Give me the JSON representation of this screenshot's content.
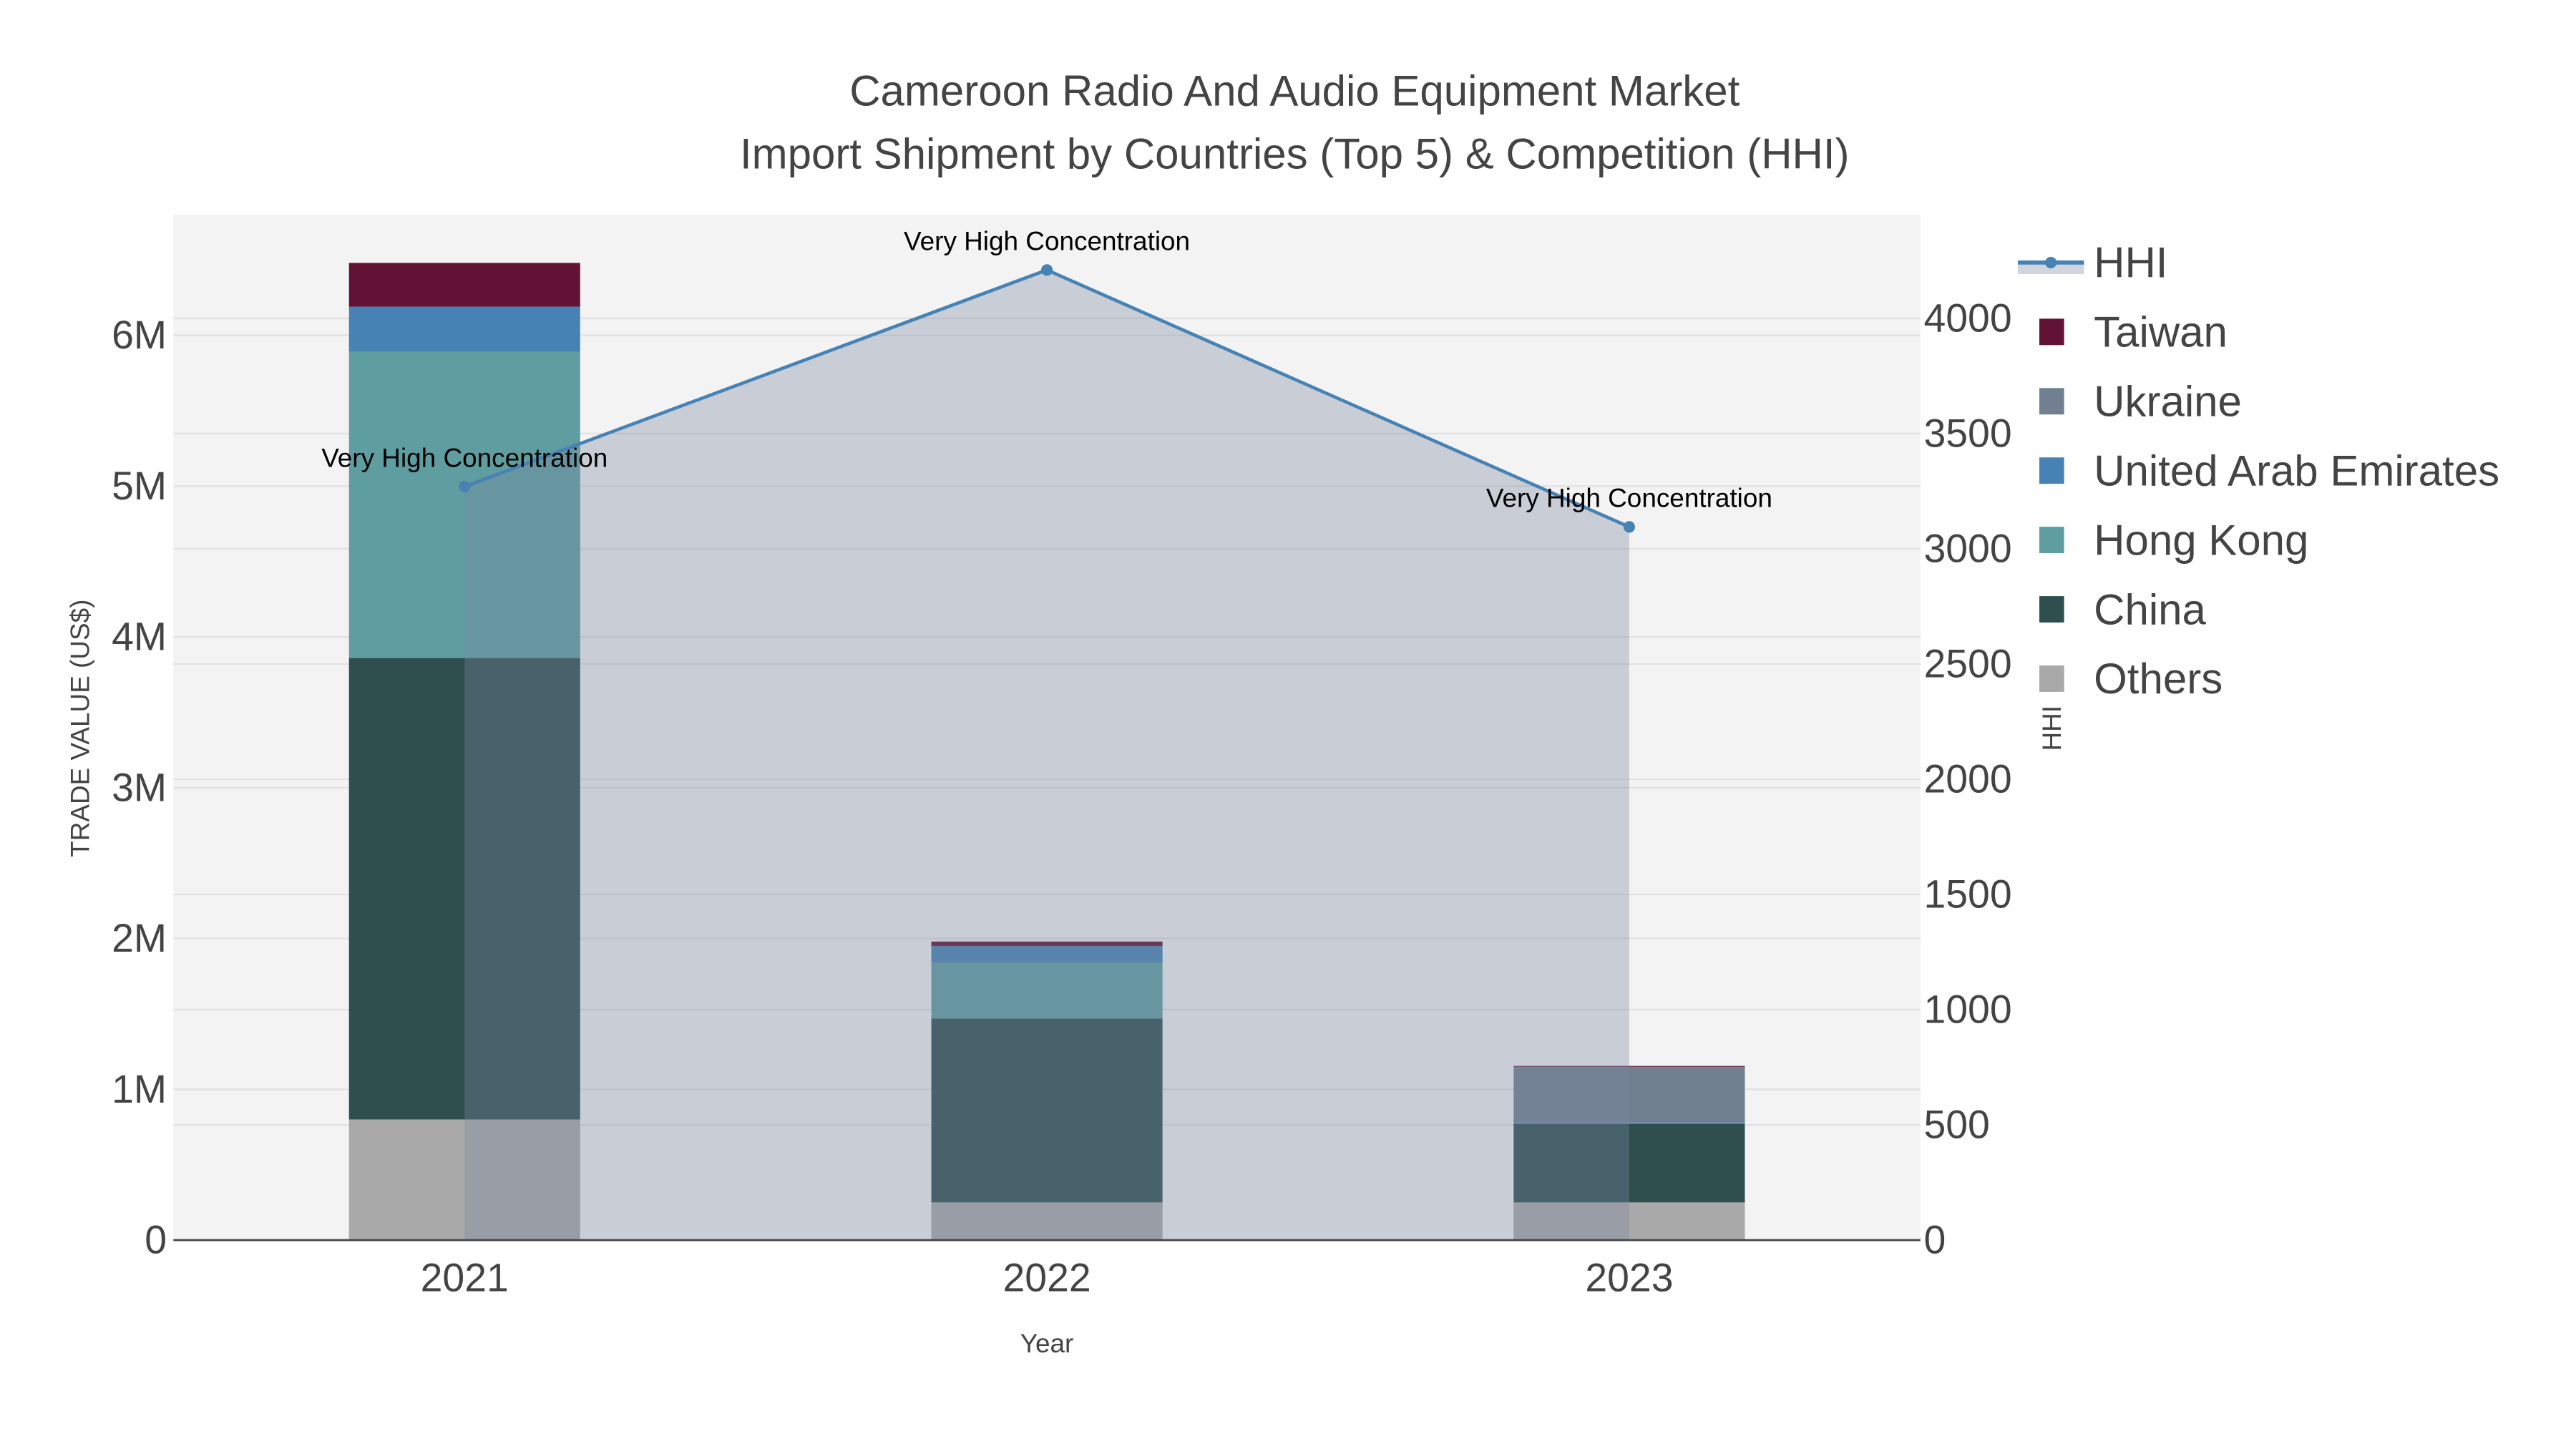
{
  "chart_data": {
    "type": "bar",
    "title_line1": "Cameroon Radio And Audio Equipment Market",
    "title_line2": "Import Shipment by Countries (Top 5) & Competition (HHI)",
    "xlabel": "Year",
    "ylabel": "TRADE VALUE (US$)",
    "y2label": "HHI",
    "categories": [
      "2021",
      "2022",
      "2023"
    ],
    "ylim": [
      0,
      6800000
    ],
    "y2lim": [
      0,
      4450
    ],
    "yticks": [
      0,
      1000000,
      2000000,
      3000000,
      4000000,
      5000000,
      6000000
    ],
    "ytick_labels": [
      "0",
      "1M",
      "2M",
      "3M",
      "4M",
      "5M",
      "6M"
    ],
    "y2ticks": [
      0,
      500,
      1000,
      1500,
      2000,
      2500,
      3000,
      3500,
      4000
    ],
    "y2tick_labels": [
      "0",
      "500",
      "1000",
      "1500",
      "2000",
      "2500",
      "3000",
      "3500",
      "4000"
    ],
    "series": [
      {
        "name": "Others",
        "color": "#a9a9a9",
        "values": [
          800000,
          250000,
          250000
        ]
      },
      {
        "name": "China",
        "color": "#2f4f4f",
        "values": [
          3060000,
          1220000,
          520000
        ]
      },
      {
        "name": "Hong Kong",
        "color": "#5f9ea0",
        "values": [
          2030000,
          370000,
          0
        ]
      },
      {
        "name": "United Arab Emirates",
        "color": "#4682b4",
        "values": [
          300000,
          110000,
          10000
        ]
      },
      {
        "name": "Ukraine",
        "color": "#708090",
        "values": [
          0,
          0,
          370000
        ]
      },
      {
        "name": "Taiwan",
        "color": "#621235",
        "values": [
          290000,
          30000,
          5000
        ]
      }
    ],
    "hhi": {
      "name": "HHI",
      "color": "#4682b4",
      "values": [
        3270,
        4210,
        3095
      ],
      "annotations": [
        "Very High Concentration",
        "Very High Concentration",
        "Very High Concentration"
      ]
    },
    "legend_order": [
      "HHI",
      "Taiwan",
      "Ukraine",
      "United Arab Emirates",
      "Hong Kong",
      "China",
      "Others"
    ],
    "legend_placement": "right",
    "grid": true
  }
}
